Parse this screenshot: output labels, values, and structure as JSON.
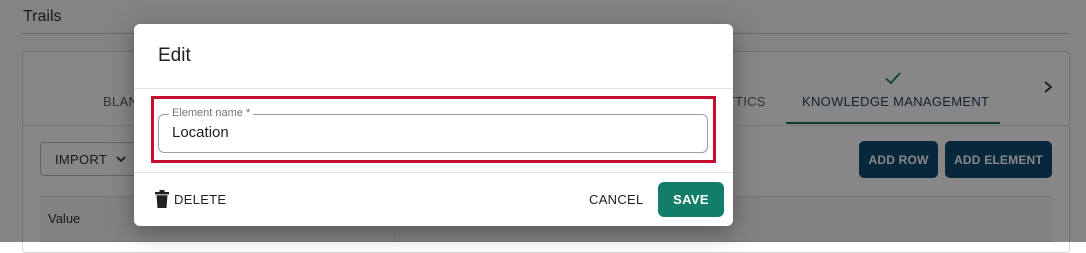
{
  "page": {
    "title": "Trails"
  },
  "tabs": [
    {
      "label": "BLAN"
    },
    {
      "label": "YTICS"
    },
    {
      "label": "KNOWLEDGE MANAGEMENT",
      "active": true
    }
  ],
  "toolbar": {
    "import_label": "IMPORT",
    "add_row_label": "ADD ROW",
    "add_element_label": "ADD ELEMENT"
  },
  "table": {
    "columns": [
      "Value"
    ]
  },
  "dialog": {
    "title": "Edit",
    "field": {
      "label": "Element name *",
      "value": "Location"
    },
    "delete_label": "DELETE",
    "cancel_label": "CANCEL",
    "save_label": "SAVE"
  },
  "colors": {
    "primary": "#127e6a",
    "dark_button": "#0e4a73",
    "highlight": "#c4102e",
    "tab_underline": "#1d6f5f"
  },
  "icons": [
    "check-icon",
    "chevron-right-icon",
    "chevron-down-icon",
    "trash-icon"
  ]
}
